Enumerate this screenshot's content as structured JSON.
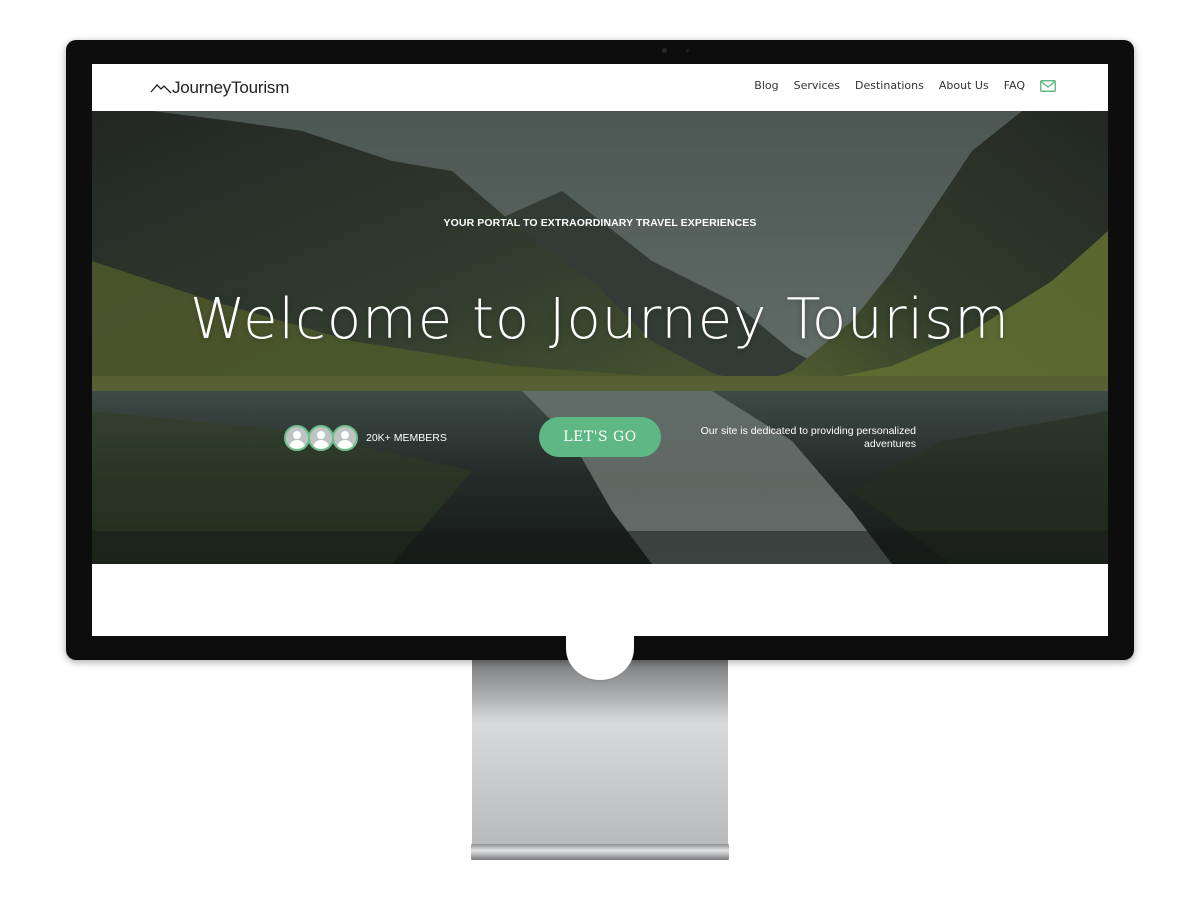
{
  "site": {
    "logo_text": "JourneyTourism"
  },
  "nav": {
    "items": [
      {
        "label": "Blog"
      },
      {
        "label": "Services"
      },
      {
        "label": "Destinations"
      },
      {
        "label": "About Us"
      },
      {
        "label": "FAQ"
      }
    ],
    "mail_icon": "mail-icon"
  },
  "hero": {
    "tagline": "YOUR PORTAL TO EXTRAORDINARY TRAVEL EXPERIENCES",
    "title": "Welcome to Journey Tourism",
    "members_label": "20K+ MEMBERS",
    "avatar_count": 3,
    "cta_label": "LET'S GO",
    "description": "Our site is dedicated to providing personalized adventures"
  },
  "colors": {
    "accent": "#5fb883",
    "monitor_bezel": "#0d0d0d",
    "stand": "#c7c8ca"
  }
}
